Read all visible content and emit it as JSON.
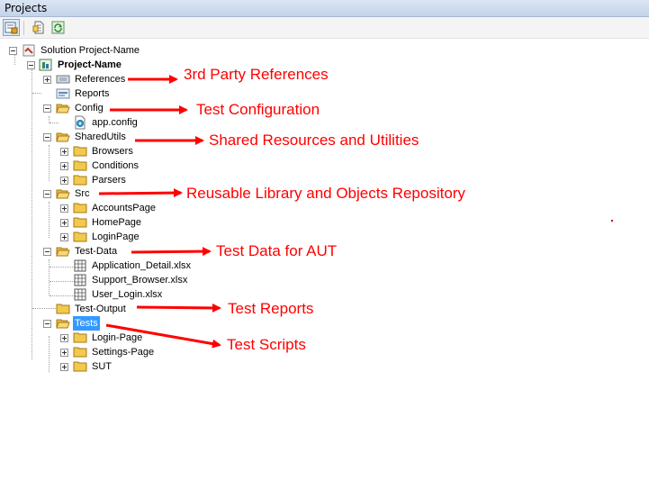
{
  "panel": {
    "title": "Projects"
  },
  "toolbar": {
    "buttons": [
      {
        "name": "properties-button",
        "icon": "properties-icon"
      },
      {
        "name": "show-all-files-button",
        "icon": "show-all-files-icon"
      },
      {
        "name": "refresh-button",
        "icon": "refresh-icon"
      }
    ]
  },
  "tree": {
    "solution": "Solution Project-Name",
    "project": "Project-Name",
    "references": "References",
    "reports": "Reports",
    "config": "Config",
    "app_config": "app.config",
    "shared_utils": "SharedUtils",
    "browsers": "Browsers",
    "conditions": "Conditions",
    "parsers": "Parsers",
    "src": "Src",
    "accounts_page": "AccountsPage",
    "home_page": "HomePage",
    "login_page": "LoginPage",
    "test_data": "Test-Data",
    "application_detail": "Application_Detail.xlsx",
    "support_browser": "Support_Browser.xlsx",
    "user_login": "User_Login.xlsx",
    "test_output": "Test-Output",
    "tests": "Tests",
    "tests_login_page": "Login-Page",
    "settings_page": "Settings-Page",
    "sut": "SUT"
  },
  "annotations": {
    "references": "3rd Party References",
    "config": "Test Configuration",
    "shared": "Shared Resources and Utilities",
    "src": "Reusable Library and Objects Repository",
    "test_data": "Test Data for AUT",
    "test_output": "Test Reports",
    "tests": "Test Scripts"
  },
  "colors": {
    "annotation": "#ff0000",
    "selection": "#3399ff",
    "titlebar": "#c3d3ea",
    "folder": "#f2c94c"
  }
}
